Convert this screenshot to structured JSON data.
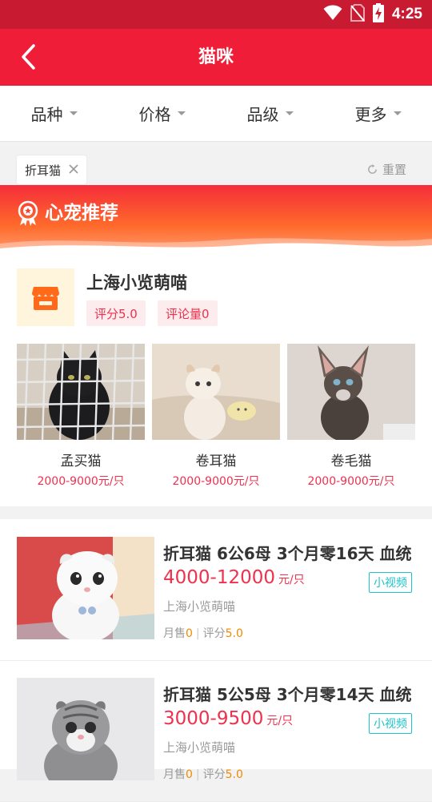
{
  "status_bar": {
    "time": "4:25"
  },
  "app_bar": {
    "title": "猫咪"
  },
  "filters": [
    {
      "label": "品种"
    },
    {
      "label": "价格"
    },
    {
      "label": "品级"
    },
    {
      "label": "更多"
    }
  ],
  "active_chip": {
    "label": "折耳猫"
  },
  "reset_label": "重置",
  "banner": {
    "title": "心宠推荐"
  },
  "shop": {
    "name": "上海小览萌喵",
    "tags": [
      "评分5.0",
      "评论量0"
    ],
    "products": [
      {
        "name": "孟买猫",
        "price": "2000-9000元/只"
      },
      {
        "name": "卷耳猫",
        "price": "2000-9000元/只"
      },
      {
        "name": "卷毛猫",
        "price": "2000-9000元/只"
      }
    ]
  },
  "listings": [
    {
      "title": "折耳猫 6公6母 3个月零16天 血统",
      "price": "4000-12000",
      "unit": "元/只",
      "badge": "小视频",
      "shop": "上海小览萌喵",
      "sales_label": "月售",
      "sales": "0",
      "rating_label": "评分",
      "rating": "5.0"
    },
    {
      "title": "折耳猫 5公5母 3个月零14天 血统",
      "price": "3000-9500",
      "unit": "元/只",
      "badge": "小视频",
      "shop": "上海小览萌喵",
      "sales_label": "月售",
      "sales": "0",
      "rating_label": "评分",
      "rating": "5.0"
    }
  ],
  "colors": {
    "status_bar": "#c81b32",
    "app_bar": "#f01d39",
    "price": "#f0304c",
    "video_badge": "#1ec2c8",
    "stat_accent": "#f08a00"
  }
}
